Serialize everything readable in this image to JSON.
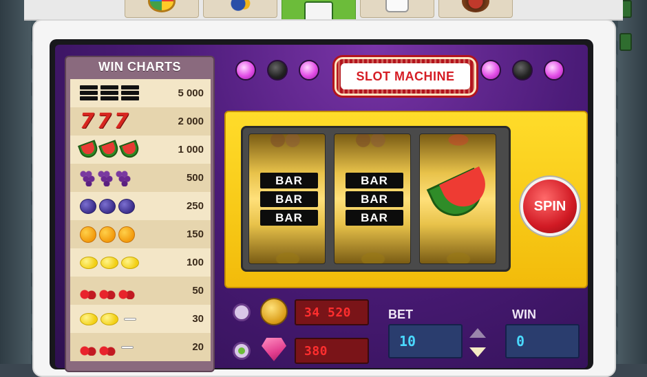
{
  "top_tabs": [
    {
      "name": "wheel-of-fortune"
    },
    {
      "name": "blackjack"
    },
    {
      "name": "slot-machine",
      "active": true
    },
    {
      "name": "dice"
    },
    {
      "name": "roulette"
    }
  ],
  "win_charts": {
    "title": "WIN CHARTS",
    "rows": [
      {
        "symbols": [
          "bar3",
          "bar3",
          "bar3"
        ],
        "payout": "5 000"
      },
      {
        "symbols": [
          "seven",
          "seven",
          "seven"
        ],
        "payout": "2 000"
      },
      {
        "symbols": [
          "melon",
          "melon",
          "melon"
        ],
        "payout": "1 000"
      },
      {
        "symbols": [
          "grape",
          "grape",
          "grape"
        ],
        "payout": "500"
      },
      {
        "symbols": [
          "plum",
          "plum",
          "plum"
        ],
        "payout": "250"
      },
      {
        "symbols": [
          "orange",
          "orange",
          "orange"
        ],
        "payout": "150"
      },
      {
        "symbols": [
          "lemon",
          "lemon",
          "lemon"
        ],
        "payout": "100"
      },
      {
        "symbols": [
          "cherry",
          "cherry",
          "cherry"
        ],
        "payout": "50"
      },
      {
        "symbols": [
          "lemon",
          "lemon",
          "dash"
        ],
        "payout": "30"
      },
      {
        "symbols": [
          "cherry",
          "cherry",
          "dash"
        ],
        "payout": "20"
      }
    ],
    "bar_text": "BAR"
  },
  "machine": {
    "title": "SLOT MACHINE",
    "reels": [
      {
        "symbol": "bar",
        "bars": [
          "BAR",
          "BAR",
          "BAR"
        ]
      },
      {
        "symbol": "bar",
        "bars": [
          "BAR",
          "BAR",
          "BAR"
        ]
      },
      {
        "symbol": "melon"
      }
    ],
    "spin_label": "SPIN"
  },
  "currency": {
    "coins_value": "34 520",
    "gems_value": "380",
    "selected": "gems"
  },
  "bet": {
    "label": "BET",
    "value": "10"
  },
  "win": {
    "label": "WIN",
    "value": "0"
  },
  "colors": {
    "accent_green": "#6cbc3a",
    "machine_purple": "#4b1b78",
    "gold": "#f2bb0a",
    "lcd_red": "#ff2e2e",
    "lcd_blue": "#4ad9ff"
  }
}
